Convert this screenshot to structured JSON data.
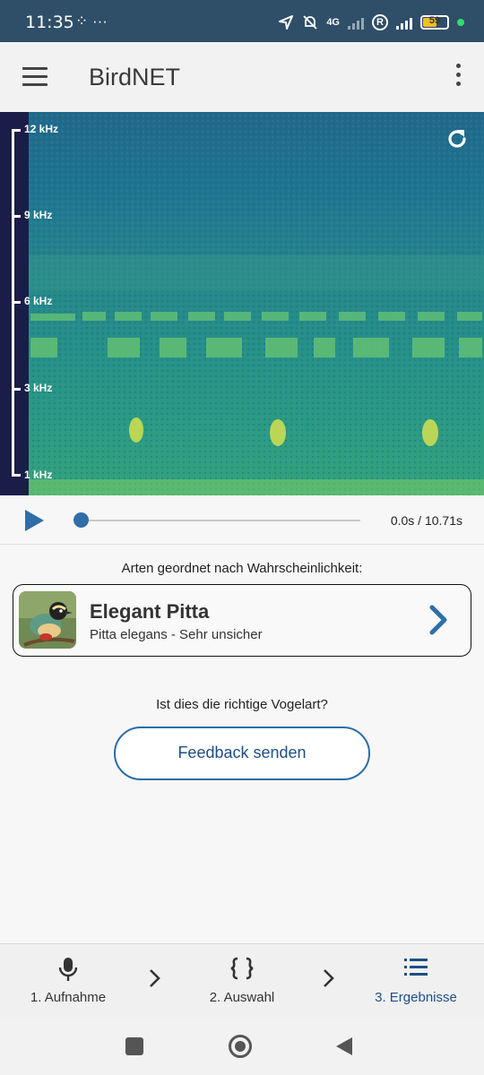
{
  "status_bar": {
    "time": "11:35",
    "extra_icons": "⁘ ···",
    "network": "4G",
    "roaming": "R",
    "battery": "59",
    "battery_level": 0.59
  },
  "app_bar": {
    "title": "BirdNET"
  },
  "spectrogram": {
    "freq_labels": [
      "12 kHz",
      "9 kHz",
      "6 kHz",
      "3 kHz",
      "1 kHz"
    ]
  },
  "player": {
    "time": "0.0s / 10.71s",
    "progress": 0.0
  },
  "results": {
    "heading": "Arten geordnet nach Wahrscheinlichkeit:",
    "species": [
      {
        "common_name": "Elegant Pitta",
        "subtitle": "Pitta elegans - Sehr unsicher"
      }
    ]
  },
  "feedback": {
    "question": "Ist dies die richtige Vogelart?",
    "button_label": "Feedback senden"
  },
  "bottom_nav": {
    "items": [
      {
        "label": "1. Aufnahme",
        "icon": "microphone-icon",
        "active": false
      },
      {
        "label": "2. Auswahl",
        "icon": "braces-icon",
        "active": false
      },
      {
        "label": "3. Ergebnisse",
        "icon": "list-icon",
        "active": true
      }
    ]
  },
  "colors": {
    "status_bar": "#2f4e68",
    "accent": "#2f6ea8",
    "active_nav": "#1d4f86",
    "axis_strip": "#1a1d48"
  }
}
